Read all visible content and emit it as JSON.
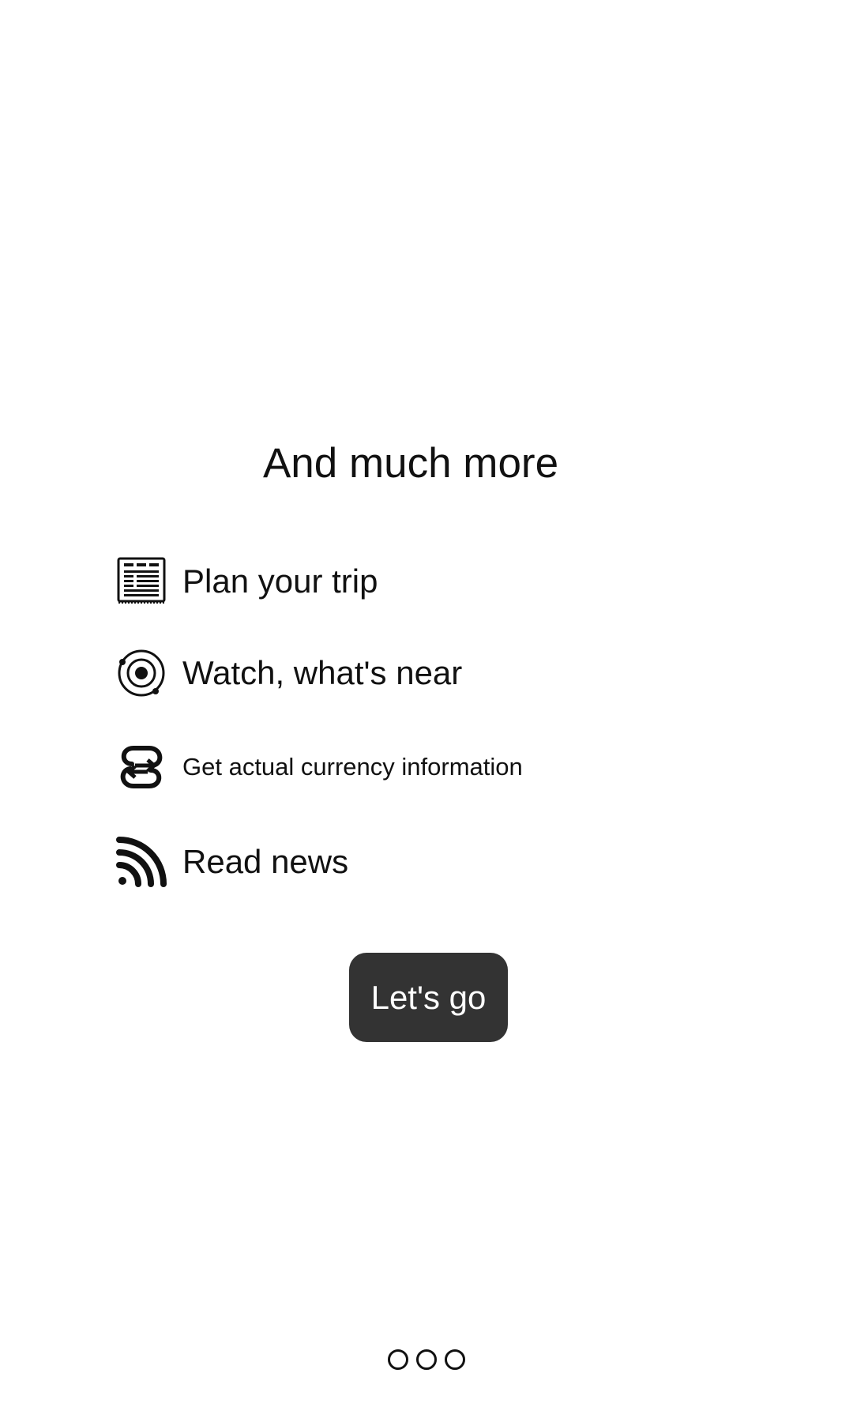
{
  "screen": {
    "title": "And much more"
  },
  "features": [
    {
      "icon": "news-list-icon",
      "label": "Plan your trip"
    },
    {
      "icon": "orbit-target-icon",
      "label": "Watch, what's near"
    },
    {
      "icon": "currency-exchange-icon",
      "label": "Get actual currency information"
    },
    {
      "icon": "rss-feed-icon",
      "label": "Read news"
    }
  ],
  "cta": {
    "label": "Let's go"
  },
  "pager": {
    "pages": 3,
    "colors": {
      "dot_border": "#111111",
      "button_bg": "#333333",
      "button_text": "#ffffff"
    }
  }
}
